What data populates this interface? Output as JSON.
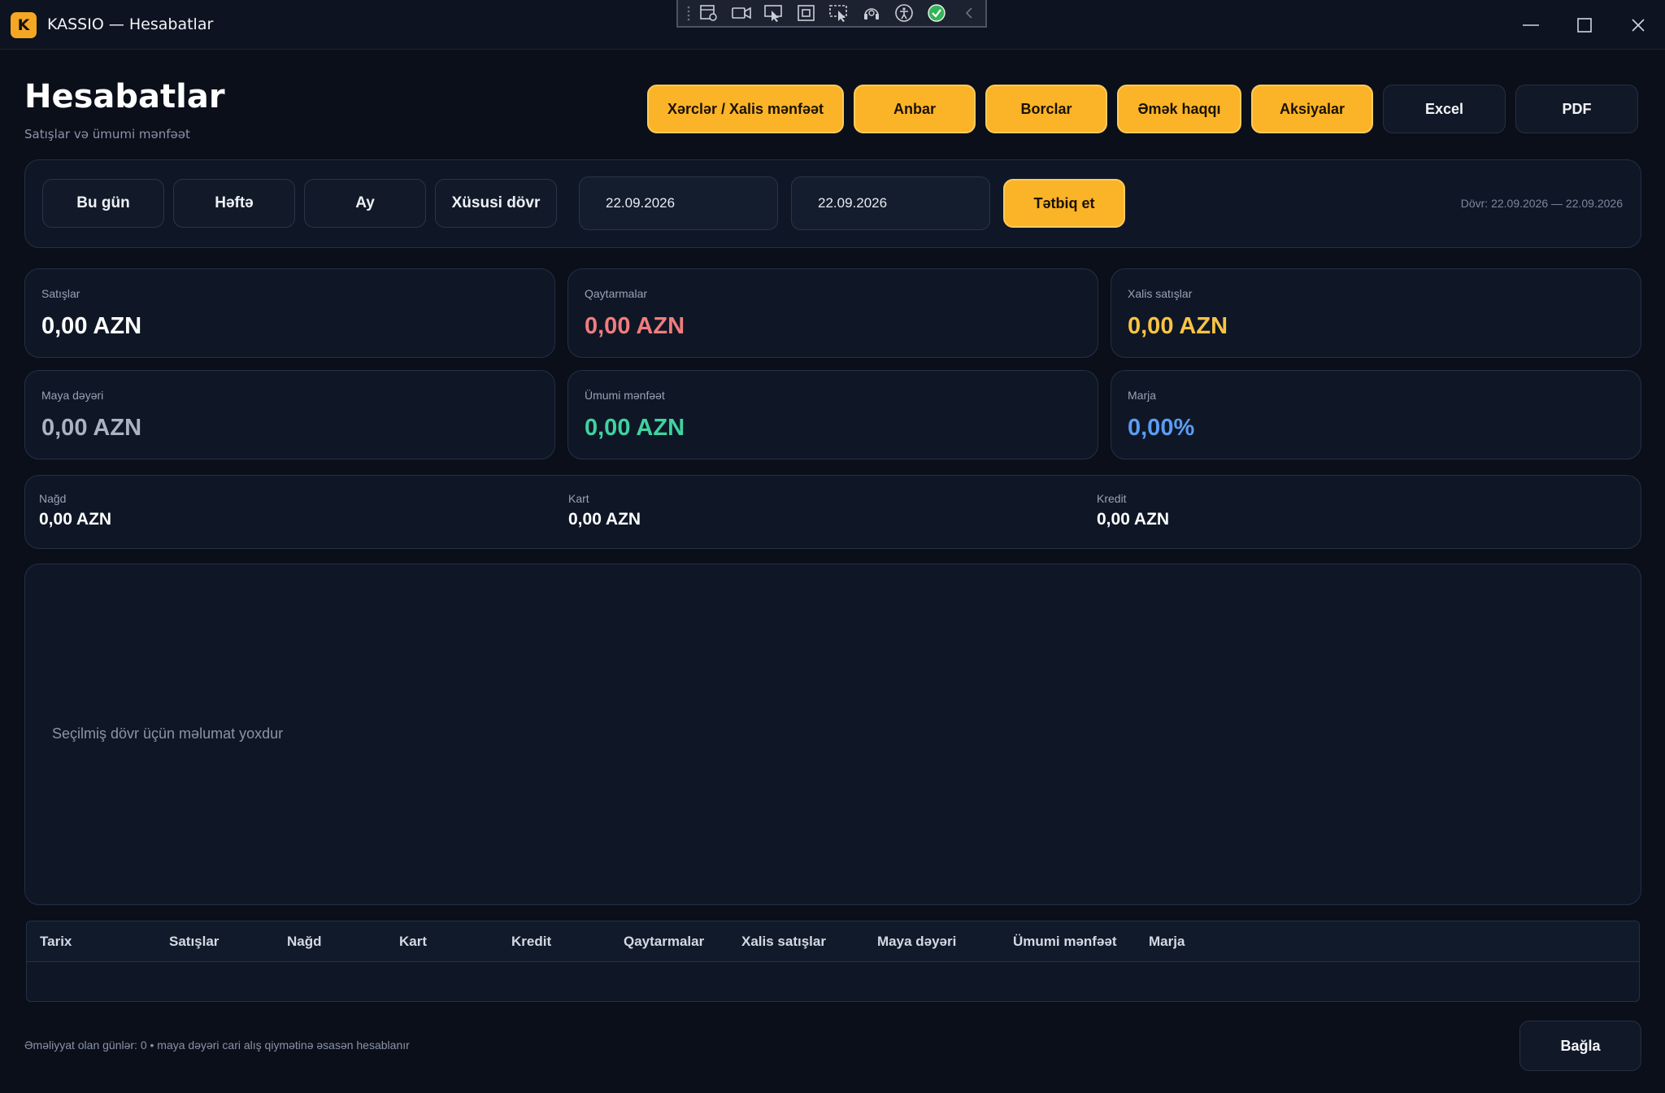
{
  "window": {
    "logo_letter": "K",
    "title": "KASSIO — Hesabatlar"
  },
  "header": {
    "title": "Hesabatlar",
    "subtitle": "Satışlar və ümumi mənfəət"
  },
  "actions": {
    "expenses": "Xərclər / Xalis mənfəət",
    "warehouse": "Anbar",
    "debts": "Borclar",
    "salary": "Əmək haqqı",
    "promotions": "Aksiyalar",
    "excel": "Excel",
    "pdf": "PDF"
  },
  "filters": {
    "today": "Bu gün",
    "week": "Həftə",
    "month": "Ay",
    "custom": "Xüsusi dövr",
    "date_from": "22.09.2026",
    "date_to": "22.09.2026",
    "apply": "Tətbiq et",
    "period": "Dövr: 22.09.2026 — 22.09.2026"
  },
  "cards": [
    {
      "label": "Satışlar",
      "value": "0,00 AZN",
      "color": "#ffffff"
    },
    {
      "label": "Qaytarmalar",
      "value": "0,00 AZN",
      "color": "#f27c7c"
    },
    {
      "label": "Xalis satışlar",
      "value": "0,00 AZN",
      "color": "#f9c443"
    },
    {
      "label": "Maya dəyəri",
      "value": "0,00 AZN",
      "color": "#aab3c2"
    },
    {
      "label": "Ümumi mənfəət",
      "value": "0,00 AZN",
      "color": "#3fd3a0"
    },
    {
      "label": "Marja",
      "value": "0,00%",
      "color": "#5b9cf5"
    }
  ],
  "payments": [
    {
      "label": "Nağd",
      "value": "0,00 AZN"
    },
    {
      "label": "Kart",
      "value": "0,00 AZN"
    },
    {
      "label": "Kredit",
      "value": "0,00 AZN"
    }
  ],
  "chart": {
    "empty_message": "Seçilmiş dövr üçün məlumat yoxdur"
  },
  "table": {
    "columns": [
      "Tarix",
      "Satışlar",
      "Nağd",
      "Kart",
      "Kredit",
      "Qaytarmalar",
      "Xalis satışlar",
      "Maya dəyəri",
      "Ümumi mənfəət",
      "Marja"
    ],
    "rows": []
  },
  "footer": {
    "note": "Əməliyyat olan günlər: 0 • maya dəyəri cari alış qiymətinə əsasən hesablanır",
    "close": "Bağla"
  },
  "icons": {
    "toolbar": [
      "grip-icon",
      "record-settings-icon",
      "video-camera-icon",
      "pointer-icon",
      "region-select-icon",
      "window-select-icon",
      "audio-icon",
      "accessibility-icon",
      "check-circle-icon",
      "collapse-chevron-icon"
    ],
    "window_controls": [
      "minimize-icon",
      "maximize-icon",
      "close-icon"
    ]
  },
  "colors": {
    "accent": "#fbb327",
    "background": "#0a0f1a",
    "panel": "#0f1726"
  }
}
